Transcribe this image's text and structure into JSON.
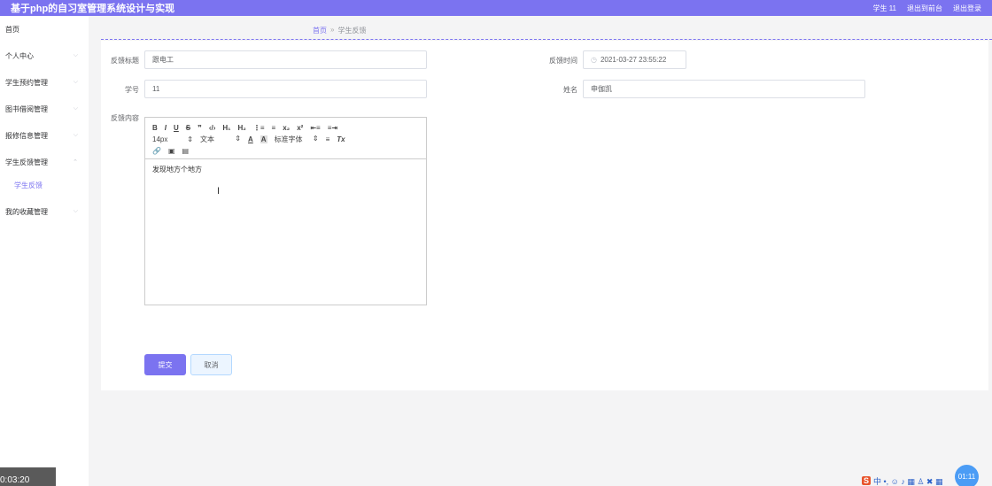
{
  "app": {
    "title": "基于php的自习室管理系统设计与实现"
  },
  "topnav": {
    "user": "学生 11",
    "exit_backend": "退出到前台",
    "logout": "退出登录"
  },
  "sidebar": {
    "home": "首页",
    "items": [
      {
        "label": "个人中心"
      },
      {
        "label": "学生预约管理"
      },
      {
        "label": "图书借阅管理"
      },
      {
        "label": "报修信息管理"
      },
      {
        "label": "学生反馈管理"
      },
      {
        "label": "我的收藏管理"
      }
    ],
    "active_sub": "学生反馈"
  },
  "breadcrumb": {
    "home": "首页",
    "sep": "»",
    "current": "学生反馈"
  },
  "form": {
    "title_label": "反馈标题",
    "title_value": "跟电工",
    "time_label": "反馈时间",
    "time_value": "2021-03-27 23:55:22",
    "id_label": "学号",
    "id_value": "11",
    "name_label": "姓名",
    "name_value": "申伽凯",
    "content_label": "反馈内容",
    "content_value": "发现地方个地方"
  },
  "editor_toolbar": {
    "row1": [
      "B",
      "I",
      "U",
      "S",
      "❞",
      "‹/›",
      "H₁",
      "H₂",
      "⋮≡",
      "≡",
      "x₂",
      "x²",
      "⇤≡",
      "≡⇥"
    ],
    "size": "14px",
    "header": "文本",
    "font": "标准字体",
    "picker_arrow": "⇕",
    "color_a": "A",
    "bg_a": "A",
    "align": "≡",
    "clear": "Tx",
    "row3": [
      "🔗",
      "▣",
      "▤"
    ]
  },
  "buttons": {
    "submit": "提交",
    "cancel": "取消"
  },
  "overlay": {
    "timer": "0:03:20",
    "float": "01:11",
    "ime_logo": "S",
    "ime_text": "中 •, ☺ ♪ ▦ ♙ ✖ ▦"
  },
  "colors": {
    "accent": "#7b73f0",
    "topbar": "#7b73f0"
  }
}
